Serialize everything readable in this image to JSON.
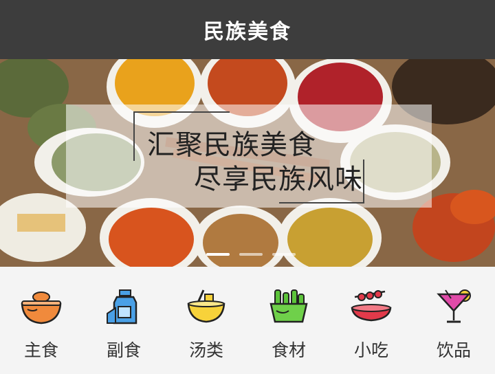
{
  "header": {
    "title": "民族美食"
  },
  "banner": {
    "line1": "汇聚民族美食",
    "line2": "尽享民族风味",
    "slides": 3,
    "active_slide": 0
  },
  "categories": [
    {
      "label": "主食",
      "icon": "rice-bowl-icon"
    },
    {
      "label": "副食",
      "icon": "milk-bottle-icon"
    },
    {
      "label": "汤类",
      "icon": "soup-bowl-icon"
    },
    {
      "label": "食材",
      "icon": "vegetable-basket-icon"
    },
    {
      "label": "小吃",
      "icon": "snack-dish-icon"
    },
    {
      "label": "饮品",
      "icon": "cocktail-glass-icon"
    }
  ],
  "colors": {
    "header_bg": "#3d3d3d",
    "accent_orange": "#f08a3c",
    "icon_yellow": "#f7d23a"
  }
}
